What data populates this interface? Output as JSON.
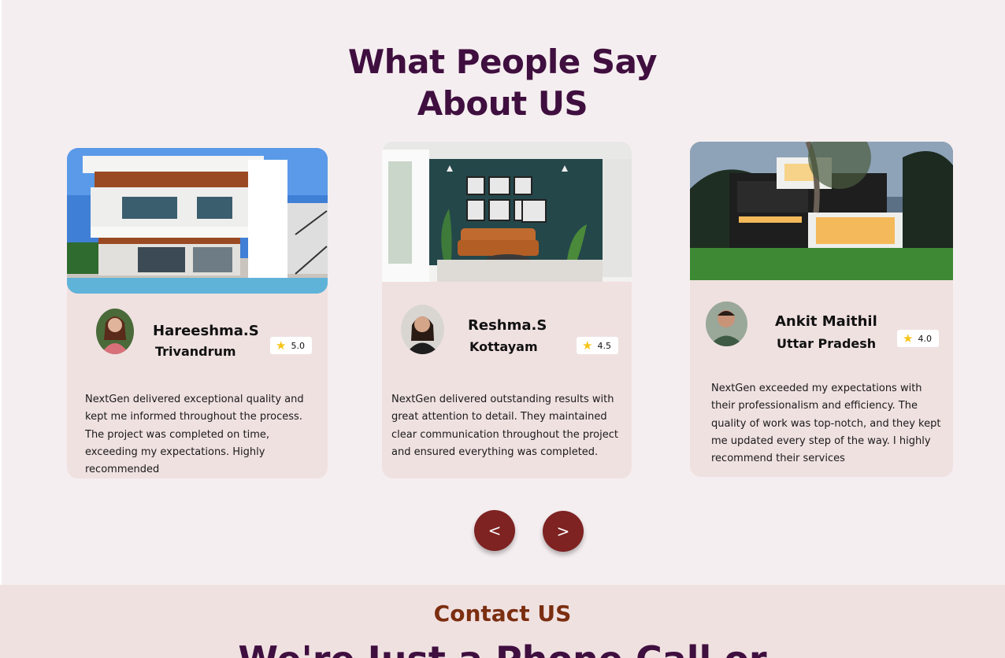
{
  "section": {
    "title_line1": "What People Say",
    "title_line2": "About US"
  },
  "testimonials": [
    {
      "name": "Hareeshma.S",
      "location": "Trivandrum",
      "rating": "5.0",
      "quote": "NextGen delivered exceptional quality and kept me informed throughout the process. The project was completed on time, exceeding my expectations. Highly recommended",
      "image": "modern-white-villa-photo",
      "avatar": "woman-avatar"
    },
    {
      "name": "Reshma.S",
      "location": "Kottayam",
      "rating": "4.5",
      "quote": "NextGen delivered outstanding results with great attention to detail. They maintained clear communication throughout the project and ensured everything was completed.",
      "image": "living-room-interior-photo",
      "avatar": "woman-avatar"
    },
    {
      "name": "Ankit Maithil",
      "location": "Uttar Pradesh",
      "rating": "4.0",
      "quote": "NextGen exceeded my expectations with their professionalism and efficiency. The quality of work was top-notch, and they kept me updated every step of the way. I highly recommend their services",
      "image": "modern-house-evening-photo",
      "avatar": "man-avatar"
    }
  ],
  "carousel": {
    "prev_label": "<",
    "next_label": ">"
  },
  "contact": {
    "title": "Contact US",
    "subtitle": "We're Just a Phone Call or"
  },
  "colors": {
    "heading": "#3f0f3f",
    "card_bg": "#f0e1e1",
    "page_bg": "#f5eef0",
    "nav_button": "#7e2222",
    "contact_title": "#7b2e10",
    "star": "#f5c518"
  }
}
